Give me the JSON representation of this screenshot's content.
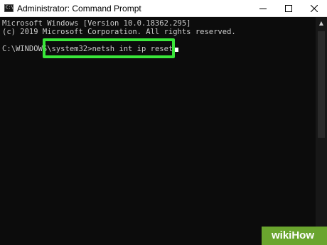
{
  "window": {
    "title": "Administrator: Command Prompt",
    "app_icon": "command-prompt-icon",
    "controls": {
      "minimize": "minimize-icon",
      "maximize": "maximize-icon",
      "close": "close-icon"
    }
  },
  "console": {
    "lines": [
      "Microsoft Windows [Version 10.0.18362.295]",
      "(c) 2019 Microsoft Corporation. All rights reserved."
    ],
    "prompt": "C:\\WINDOWS\\system32>",
    "command": "netsh int ip reset"
  },
  "highlight_color": "#39e639",
  "colors": {
    "console_bg": "#0c0c0c",
    "console_text": "#cccccc",
    "titlebar_bg": "#ffffff",
    "watermark_bg": "#6aa52e"
  },
  "watermark": {
    "text": "wikiHow"
  }
}
